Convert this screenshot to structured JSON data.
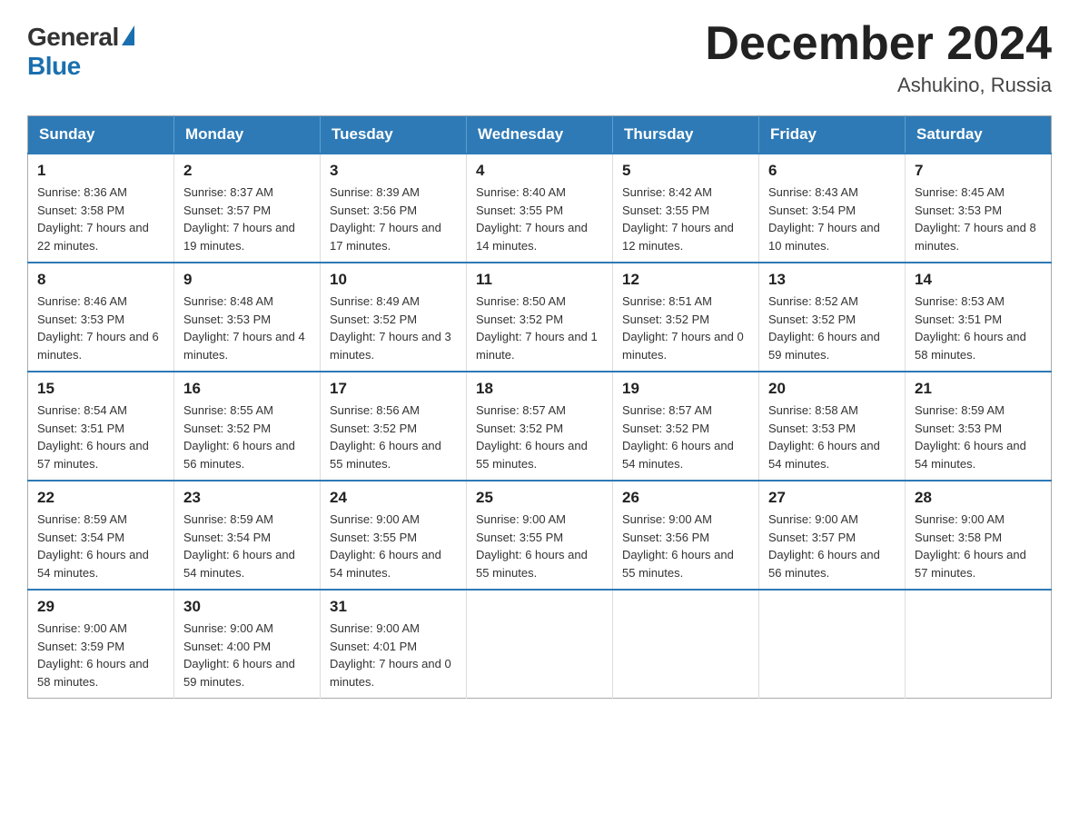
{
  "logo": {
    "general": "General",
    "blue": "Blue"
  },
  "title": "December 2024",
  "location": "Ashukino, Russia",
  "days_header": [
    "Sunday",
    "Monday",
    "Tuesday",
    "Wednesday",
    "Thursday",
    "Friday",
    "Saturday"
  ],
  "weeks": [
    [
      {
        "day": "1",
        "sunrise": "8:36 AM",
        "sunset": "3:58 PM",
        "daylight": "7 hours and 22 minutes."
      },
      {
        "day": "2",
        "sunrise": "8:37 AM",
        "sunset": "3:57 PM",
        "daylight": "7 hours and 19 minutes."
      },
      {
        "day": "3",
        "sunrise": "8:39 AM",
        "sunset": "3:56 PM",
        "daylight": "7 hours and 17 minutes."
      },
      {
        "day": "4",
        "sunrise": "8:40 AM",
        "sunset": "3:55 PM",
        "daylight": "7 hours and 14 minutes."
      },
      {
        "day": "5",
        "sunrise": "8:42 AM",
        "sunset": "3:55 PM",
        "daylight": "7 hours and 12 minutes."
      },
      {
        "day": "6",
        "sunrise": "8:43 AM",
        "sunset": "3:54 PM",
        "daylight": "7 hours and 10 minutes."
      },
      {
        "day": "7",
        "sunrise": "8:45 AM",
        "sunset": "3:53 PM",
        "daylight": "7 hours and 8 minutes."
      }
    ],
    [
      {
        "day": "8",
        "sunrise": "8:46 AM",
        "sunset": "3:53 PM",
        "daylight": "7 hours and 6 minutes."
      },
      {
        "day": "9",
        "sunrise": "8:48 AM",
        "sunset": "3:53 PM",
        "daylight": "7 hours and 4 minutes."
      },
      {
        "day": "10",
        "sunrise": "8:49 AM",
        "sunset": "3:52 PM",
        "daylight": "7 hours and 3 minutes."
      },
      {
        "day": "11",
        "sunrise": "8:50 AM",
        "sunset": "3:52 PM",
        "daylight": "7 hours and 1 minute."
      },
      {
        "day": "12",
        "sunrise": "8:51 AM",
        "sunset": "3:52 PM",
        "daylight": "7 hours and 0 minutes."
      },
      {
        "day": "13",
        "sunrise": "8:52 AM",
        "sunset": "3:52 PM",
        "daylight": "6 hours and 59 minutes."
      },
      {
        "day": "14",
        "sunrise": "8:53 AM",
        "sunset": "3:51 PM",
        "daylight": "6 hours and 58 minutes."
      }
    ],
    [
      {
        "day": "15",
        "sunrise": "8:54 AM",
        "sunset": "3:51 PM",
        "daylight": "6 hours and 57 minutes."
      },
      {
        "day": "16",
        "sunrise": "8:55 AM",
        "sunset": "3:52 PM",
        "daylight": "6 hours and 56 minutes."
      },
      {
        "day": "17",
        "sunrise": "8:56 AM",
        "sunset": "3:52 PM",
        "daylight": "6 hours and 55 minutes."
      },
      {
        "day": "18",
        "sunrise": "8:57 AM",
        "sunset": "3:52 PM",
        "daylight": "6 hours and 55 minutes."
      },
      {
        "day": "19",
        "sunrise": "8:57 AM",
        "sunset": "3:52 PM",
        "daylight": "6 hours and 54 minutes."
      },
      {
        "day": "20",
        "sunrise": "8:58 AM",
        "sunset": "3:53 PM",
        "daylight": "6 hours and 54 minutes."
      },
      {
        "day": "21",
        "sunrise": "8:59 AM",
        "sunset": "3:53 PM",
        "daylight": "6 hours and 54 minutes."
      }
    ],
    [
      {
        "day": "22",
        "sunrise": "8:59 AM",
        "sunset": "3:54 PM",
        "daylight": "6 hours and 54 minutes."
      },
      {
        "day": "23",
        "sunrise": "8:59 AM",
        "sunset": "3:54 PM",
        "daylight": "6 hours and 54 minutes."
      },
      {
        "day": "24",
        "sunrise": "9:00 AM",
        "sunset": "3:55 PM",
        "daylight": "6 hours and 54 minutes."
      },
      {
        "day": "25",
        "sunrise": "9:00 AM",
        "sunset": "3:55 PM",
        "daylight": "6 hours and 55 minutes."
      },
      {
        "day": "26",
        "sunrise": "9:00 AM",
        "sunset": "3:56 PM",
        "daylight": "6 hours and 55 minutes."
      },
      {
        "day": "27",
        "sunrise": "9:00 AM",
        "sunset": "3:57 PM",
        "daylight": "6 hours and 56 minutes."
      },
      {
        "day": "28",
        "sunrise": "9:00 AM",
        "sunset": "3:58 PM",
        "daylight": "6 hours and 57 minutes."
      }
    ],
    [
      {
        "day": "29",
        "sunrise": "9:00 AM",
        "sunset": "3:59 PM",
        "daylight": "6 hours and 58 minutes."
      },
      {
        "day": "30",
        "sunrise": "9:00 AM",
        "sunset": "4:00 PM",
        "daylight": "6 hours and 59 minutes."
      },
      {
        "day": "31",
        "sunrise": "9:00 AM",
        "sunset": "4:01 PM",
        "daylight": "7 hours and 0 minutes."
      },
      null,
      null,
      null,
      null
    ]
  ]
}
